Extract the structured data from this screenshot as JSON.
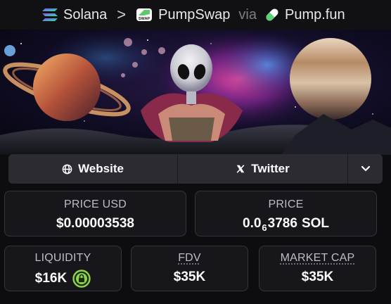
{
  "breadcrumb": {
    "chain": "Solana",
    "dex": "PumpSwap",
    "via": "via",
    "launchpad": "Pump.fun",
    "dex_icon_text": "SWAP"
  },
  "banner": {
    "description": "space artwork"
  },
  "socials": {
    "website_label": "Website",
    "twitter_label": "Twitter",
    "website_icon": "globe-icon",
    "twitter_icon": "x-logo-icon",
    "more_icon": "chevron-down-icon"
  },
  "stats": {
    "price_usd": {
      "label": "PRICE USD",
      "value": "$0.00003538"
    },
    "price_native": {
      "label": "PRICE",
      "prefix": "0.0",
      "zeros": "6",
      "digits": "3786",
      "unit": "SOL"
    },
    "liquidity": {
      "label": "LIQUIDITY",
      "value": "$16K",
      "icon": "lock-icon"
    },
    "fdv": {
      "label": "FDV",
      "value": "$35K"
    },
    "market_cap": {
      "label": "MARKET CAP",
      "value": "$35K"
    }
  },
  "colors": {
    "background": "#0d0d10",
    "card_bg": "#17171b",
    "card_border": "#34343b",
    "lock_green": "#8bd34a",
    "via_gray": "#7d7d85"
  }
}
